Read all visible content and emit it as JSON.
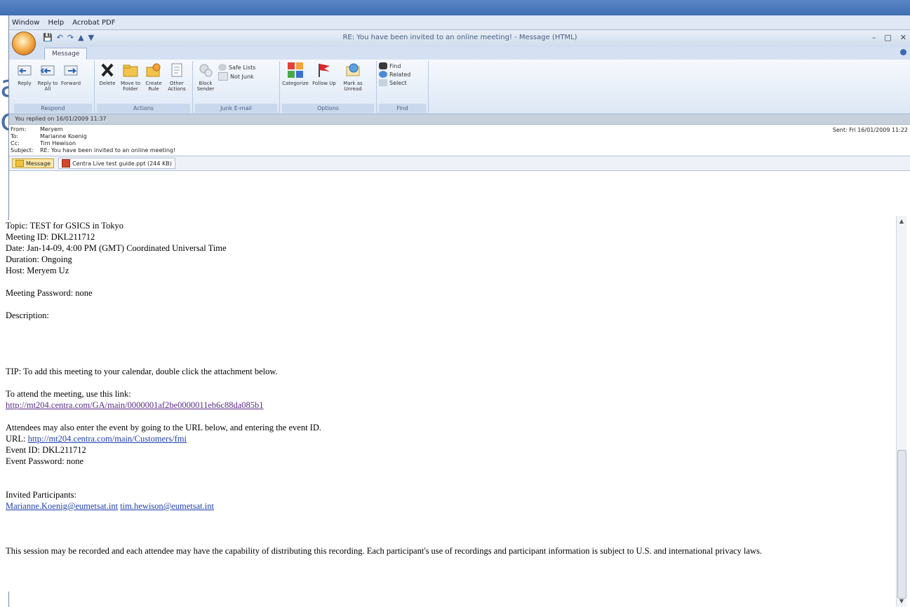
{
  "window": {
    "menu": [
      "Window",
      "Help",
      "Acrobat PDF"
    ],
    "title": "RE: You have been invited to an online meeting! - Message (HTML)",
    "tab": "Message"
  },
  "ribbon": {
    "respond": {
      "label": "Respond",
      "reply": "Reply",
      "reply_all": "Reply to All",
      "forward": "Forward"
    },
    "actions": {
      "label": "Actions",
      "delete": "Delete",
      "move": "Move to Folder",
      "create_rule": "Create Rule",
      "other": "Other Actions"
    },
    "junk": {
      "label": "Junk E-mail",
      "block": "Block Sender",
      "safe_lists": "Safe Lists",
      "not_junk": "Not Junk"
    },
    "options": {
      "label": "Options",
      "categorize": "Categorize",
      "follow_up": "Follow Up",
      "mark_unread": "Mark as Unread"
    },
    "find": {
      "label": "Find",
      "find": "Find",
      "related": "Related",
      "select": "Select"
    }
  },
  "message": {
    "info": "You replied on 16/01/2009 11:37",
    "from_label": "From:",
    "from": "Meryem",
    "to_label": "To:",
    "to": "Marianne Koenig",
    "cc_label": "Cc:",
    "cc": "Tim Hewison",
    "subject_label": "Subject:",
    "subject": "RE: You have been invited to an online meeting!",
    "sent_label": "Sent:",
    "sent": "Fri 16/01/2009 11:22",
    "attachments": [
      "Message",
      "Centra Live test guide.ppt (244 KB)"
    ]
  },
  "body": {
    "topic": "Topic: TEST for GSICS in Tokyo",
    "meeting_id": "Meeting ID: DKL211712",
    "date": "Date: Jan-14-09, 4:00 PM (GMT) Coordinated Universal Time",
    "duration": "Duration: Ongoing",
    "host": "Host: Meryem Uz",
    "password": "Meeting Password: none",
    "description": "Description:",
    "tip": "TIP: To add this meeting to your calendar, double click the attachment below.",
    "attend": "To attend the meeting, use this link:",
    "attend_link": "http://mt204.centra.com/GA/main/0000001af2be0000011eb6c88da085b1",
    "attendees": "Attendees may also enter the event by going to the URL below, and entering the event ID.",
    "url_label": "URL: ",
    "url_link": "http://mt204.centra.com/main/Customers/fmi",
    "event_id": "Event ID: DKL211712",
    "event_password": "Event Password: none",
    "invited": "Invited Participants:",
    "participant1": "Marianne.Koenig@eumetsat.int",
    "participant2": "tim.hewison@eumetsat.int",
    "disclaimer": "This session may be recorded and each attendee may have the capability of distributing this recording. Each participant's use of recordings and participant information is subject to U.S. and international privacy laws."
  }
}
